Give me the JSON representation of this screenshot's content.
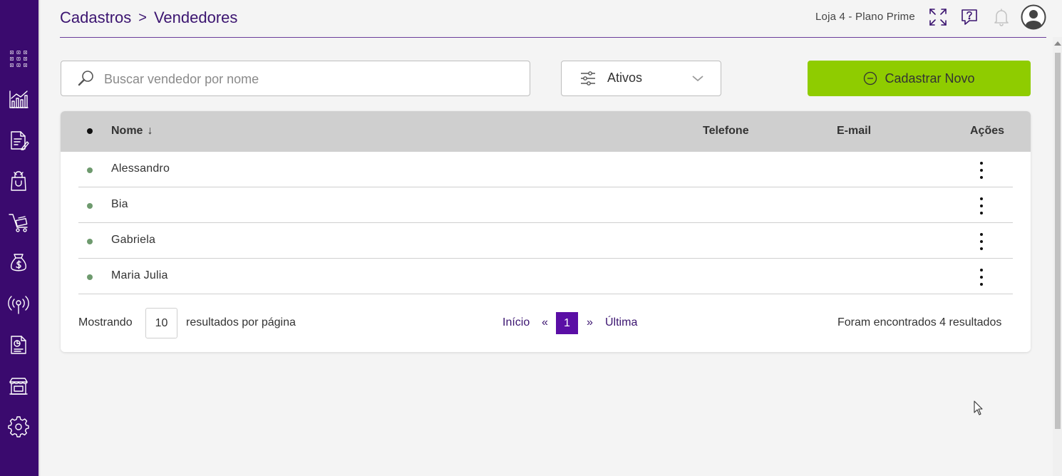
{
  "breadcrumb": {
    "parent": "Cadastros",
    "separator": ">",
    "current": "Vendedores"
  },
  "header": {
    "store": "Loja 4 - Plano Prime"
  },
  "sidebar": {
    "items": [
      {
        "icon": "apps-grid-icon"
      },
      {
        "icon": "chart-icon"
      },
      {
        "icon": "document-edit-icon"
      },
      {
        "icon": "shopping-bag-icon"
      },
      {
        "icon": "cart-icon"
      },
      {
        "icon": "money-bag-icon"
      },
      {
        "icon": "broadcast-icon"
      },
      {
        "icon": "report-icon"
      },
      {
        "icon": "store-icon"
      },
      {
        "icon": "gear-icon"
      }
    ]
  },
  "search": {
    "placeholder": "Buscar vendedor por nome",
    "value": ""
  },
  "filter": {
    "selected": "Ativos"
  },
  "new_button": {
    "label": "Cadastrar Novo",
    "color": "#8fcc00"
  },
  "table": {
    "columns": {
      "name": "Nome",
      "sort_indicator": "↓",
      "phone": "Telefone",
      "email": "E-mail",
      "actions": "Ações"
    },
    "rows": [
      {
        "name": "Alessandro",
        "phone": "",
        "email": "",
        "status_color": "#6e9a6e"
      },
      {
        "name": "Bia",
        "phone": "",
        "email": "",
        "status_color": "#6e9a6e"
      },
      {
        "name": "Gabriela",
        "phone": "",
        "email": "",
        "status_color": "#6e9a6e"
      },
      {
        "name": "Maria Julia",
        "phone": "",
        "email": "",
        "status_color": "#6e9a6e"
      }
    ]
  },
  "footer": {
    "showing_label": "Mostrando",
    "page_size": "10",
    "per_page_label": "resultados por página",
    "first_label": "Início",
    "prev_label": "«",
    "current_page": "1",
    "next_label": "»",
    "last_label": "Última",
    "results_text": "Foram encontrados 4 resultados"
  },
  "colors": {
    "sidebar": "#3a0a6e",
    "accent": "#5a0ea5",
    "primary_text": "#3b1470"
  }
}
